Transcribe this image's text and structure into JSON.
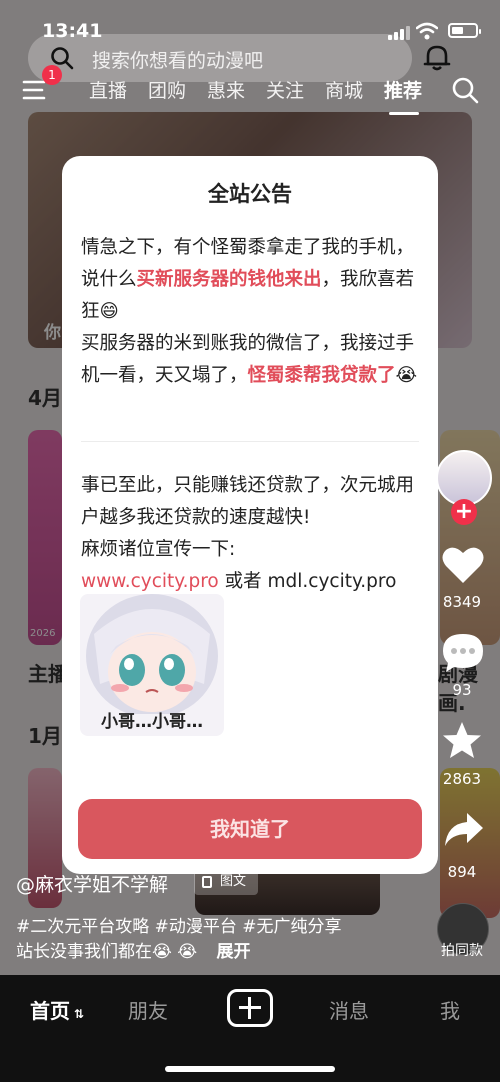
{
  "status_bar": {
    "time": "13:41"
  },
  "top": {
    "search_placeholder": "搜索你想看的动漫吧",
    "menu_badge": "1",
    "tabs": [
      "直播",
      "团购",
      "惠来",
      "关注",
      "商城",
      "推荐"
    ]
  },
  "background": {
    "section_label_1": "4月",
    "section_label_2": "主播",
    "section_label_3": "1月",
    "card_text_1": "你",
    "card_text_2": "剧漫画.",
    "card_year": "2026"
  },
  "modal": {
    "title": "全站公告",
    "p1_a": "情急之下，有个怪蜀黍拿走了我的手机，说什么",
    "p1_red": "买新服务器的钱他来出",
    "p1_b": "，我欣喜若狂😄",
    "p2_a": "买服务器的米到账我的微信了，我接过手机一看，天又塌了，",
    "p2_red": "怪蜀黍帮我贷款了",
    "p2_emoji": "😭",
    "p3": "事已至此，只能赚钱还贷款了，次元城用户越多我还贷款的速度越快!",
    "p4": "麻烦诸位宣传一下:",
    "link1": "www.cycity.pro",
    "or_text": "或者",
    "link2": "mdl.cycity.pro",
    "sticker_caption": "小哥…小哥…",
    "ok_button": "我知道了"
  },
  "side_actions": {
    "likes": "8349",
    "comments": "93",
    "favorites": "2863",
    "shares": "894",
    "same_label": "拍同款"
  },
  "post": {
    "author": "@麻衣学姐不学解",
    "tag": "图文",
    "hashtags": "#二次元平台攻略 #动漫平台 #无广纯分享",
    "desc": "站长没事我们都在😭 😭",
    "expand": "展开"
  },
  "bottom_nav": {
    "home": "首页",
    "friends": "朋友",
    "messages": "消息",
    "me": "我"
  },
  "colors": {
    "accent_red": "#e14d5a",
    "button_red": "#d9575e",
    "badge_red": "#f0304a"
  }
}
